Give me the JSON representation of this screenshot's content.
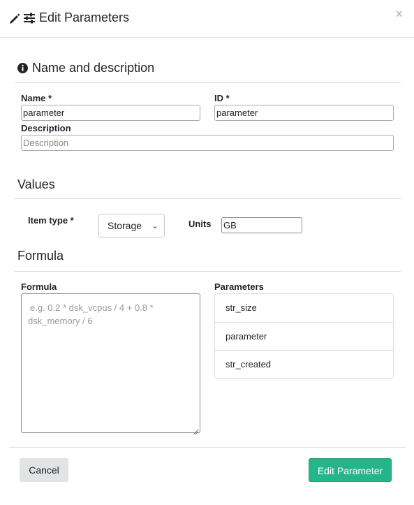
{
  "header": {
    "title": "Edit Parameters",
    "close": "×"
  },
  "name_section": {
    "title": "Name and description",
    "name_label": "Name *",
    "name_value": "parameter",
    "id_label": "ID *",
    "id_value": "parameter",
    "description_label": "Description",
    "description_placeholder": "Description"
  },
  "values_section": {
    "title": "Values",
    "item_type_label": "Item type *",
    "item_type_value": "Storage",
    "units_label": "Units",
    "units_value": "GB"
  },
  "formula_section": {
    "title": "Formula",
    "formula_label": "Formula",
    "formula_placeholder_line1": "e.g. 0.2 * dsk_vcpus / 4 + 0.8 *",
    "formula_placeholder_line2": "dsk_memory / 6",
    "parameters_label": "Parameters",
    "parameters": [
      "str_size",
      "parameter",
      "str_created"
    ]
  },
  "footer": {
    "cancel": "Cancel",
    "submit": "Edit Parameter"
  },
  "colors": {
    "primary": "#25b58a",
    "cancel_bg": "#e2e3e5"
  }
}
